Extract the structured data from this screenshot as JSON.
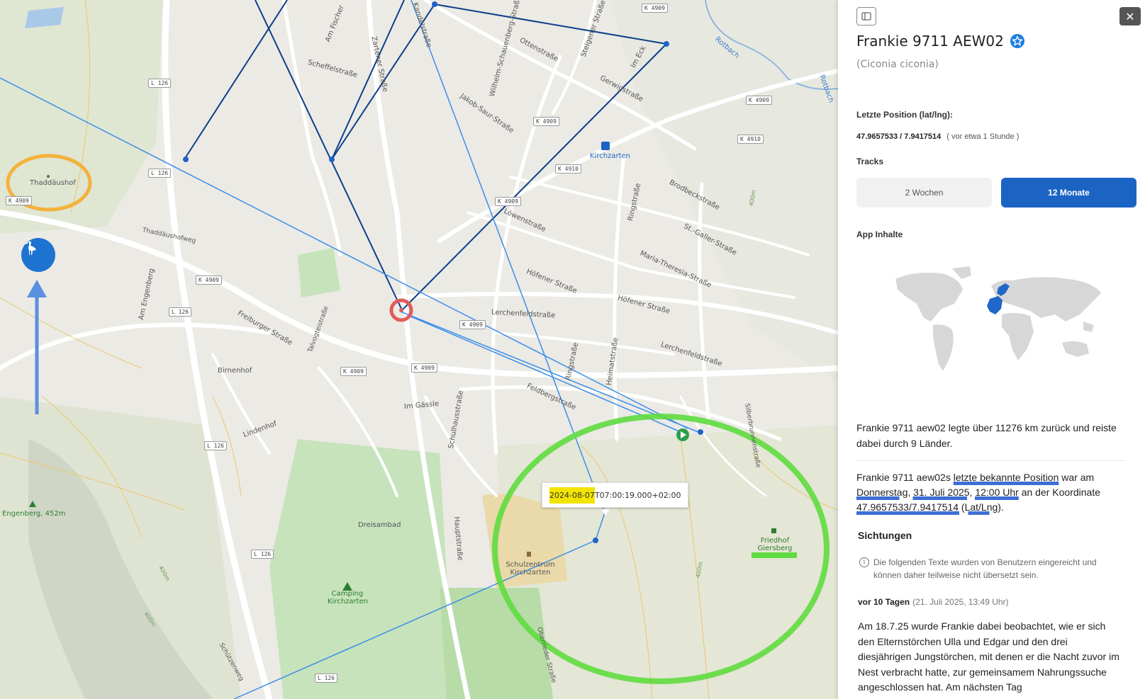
{
  "map": {
    "place_labels": {
      "thaddaushof": "Thaddäushof",
      "thaddaushofweg": "Thaddäushofweg",
      "am_engenberg": "Am Engenberg",
      "freiburger_strasse": "Freiburger Straße",
      "birnenhof": "Birnenhof",
      "lindenhof": "Lindenhof",
      "talvogtei": "Talvogteistraße",
      "scheffelstrasse": "Scheffelstraße",
      "am_fischer": "Am Fischer",
      "zartener_strasse": "Zartener Straße",
      "kandelstrasse": "Kandelstraße",
      "wilhelm": "Wilhelm-Schauenberg-Straße",
      "ottenstrasse": "Ottenstraße",
      "jakob": "Jakob-Saur-Straße",
      "gerwigstrasse": "Gerwigstraße",
      "im_eck": "Im Eck",
      "steigener": "Steigener Straße",
      "rotbach1": "Rotbach",
      "rotbach2": "Rotbach",
      "kirchzarten": "Kirchzarten",
      "lowenstrasse": "Löwenstraße",
      "brodbeckstrasse": "Brodbeckstraße",
      "ringstrasse1": "Ringstraße",
      "st_galler": "St.-Galler-Straße",
      "maria_theresia": "Maria-Theresia-Straße",
      "hofener1": "Höfener Straße",
      "hofener2": "Höfener Straße",
      "lerchenfeld1": "Lerchenfeldstraße",
      "lerchenfeld2": "Lerchenfeldstraße",
      "feldbergstrasse": "Feldbergstraße",
      "ringstrasse2": "Ringstraße",
      "heimatstrasse": "Heimatstraße",
      "im_gassle": "Im Gässle",
      "schulhausstrasse": "Schulhausstraße",
      "hauptstrasse": "Hauptstraße",
      "silberbrunnen": "Silberbrunnenstraße",
      "oberrieder": "Oberrieder Straße",
      "schutzenweg": "Schützenweg",
      "contour1": "400m",
      "contour2": "400m",
      "contour3": "400m",
      "contour4": "400m"
    },
    "road_badges": {
      "k4909_top": "K 4909",
      "l126_a": "L 126",
      "l126_b": "L 126",
      "k4909_left": "K 4909",
      "k4909_b": "K 4909",
      "k4909_c": "K 4909",
      "k4909_d": "K 4909",
      "k4909_e": "K 4909",
      "k4909_f": "K 4909",
      "k4909_g": "K 4909",
      "k4909_h": "K 4909",
      "k4909_right": "K 4909",
      "k4910_a": "K 4910",
      "k4910_b": "K 4910",
      "l126_c": "L 126",
      "l126_d": "L 126",
      "l126_e": "L 126",
      "l126_f": "L 126"
    },
    "poi": {
      "engenberg": "Engenberg, 452m",
      "dreisambad": "Dreisambad",
      "camping": "Camping Kirchzarten",
      "schulzentrum": "Schulzentrum Kirchzarten",
      "friedhof": "Friedhof Giersberg"
    },
    "tooltip": {
      "date": "2024-08-07",
      "time": "T07:00:19.000+02:00"
    },
    "colors": {
      "track_dark": "#0b3f8a",
      "track_light": "#3b8fe8",
      "annotation_green": "#5fdc3f",
      "annotation_orange": "#f4b23c",
      "annotation_blue_arrow": "#5b8fe0",
      "marker": "#e35b5b"
    },
    "stork_marker_icon": "stork-icon"
  },
  "panel": {
    "collapse_icon": "sidebar-toggle-icon",
    "close_label": "✕",
    "bird_name": "Frankie 9711 AEW02",
    "verified_icon": "verified-star-icon",
    "species": "(Ciconia ciconia)",
    "last_position_label": "Letzte Position (lat/lng):",
    "coordinates": "47.9657533 / 7.9417514",
    "relative_time": "( vor etwa 1 Stunde )",
    "tracks_label": "Tracks",
    "tracks": {
      "two_weeks": "2 Wochen",
      "twelve_months": "12 Monate"
    },
    "app_content_label": "App Inhalte",
    "summary": "Frankie 9711 aew02 legte über 11276 km zurück und reiste dabei durch 9 Länder.",
    "last_known": {
      "part1": "Frankie 9711 aew02s ",
      "link1": "letzte bekannte Position",
      "part2": " war am ",
      "date": "Donnerstag, 31. Juli 2025, 12:00 Uhr",
      "part3": " an der Koordinate ",
      "coord": "47.9657533/7.9417514 (Lat/Lng)",
      "part4": "."
    },
    "sightings_title": "Sichtungen",
    "disclaimer": "Die folgenden Texte wurden von Benutzern eingereicht und können daher teilweise nicht übersetzt sein.",
    "sighting": {
      "ago": "vor 10 Tagen",
      "date": "(21. Juli 2025, 13:49 Uhr)",
      "text": "Am 18.7.25 wurde Frankie dabei beobachtet, wie er sich den Elternstörchen Ulla und Edgar und den drei diesjährigen Jungstörchen, mit denen er die Nacht zuvor im Nest verbracht hatte, zur gemeinsamem Nahrungssuche angeschlossen hat. Am nächsten Tag"
    }
  }
}
